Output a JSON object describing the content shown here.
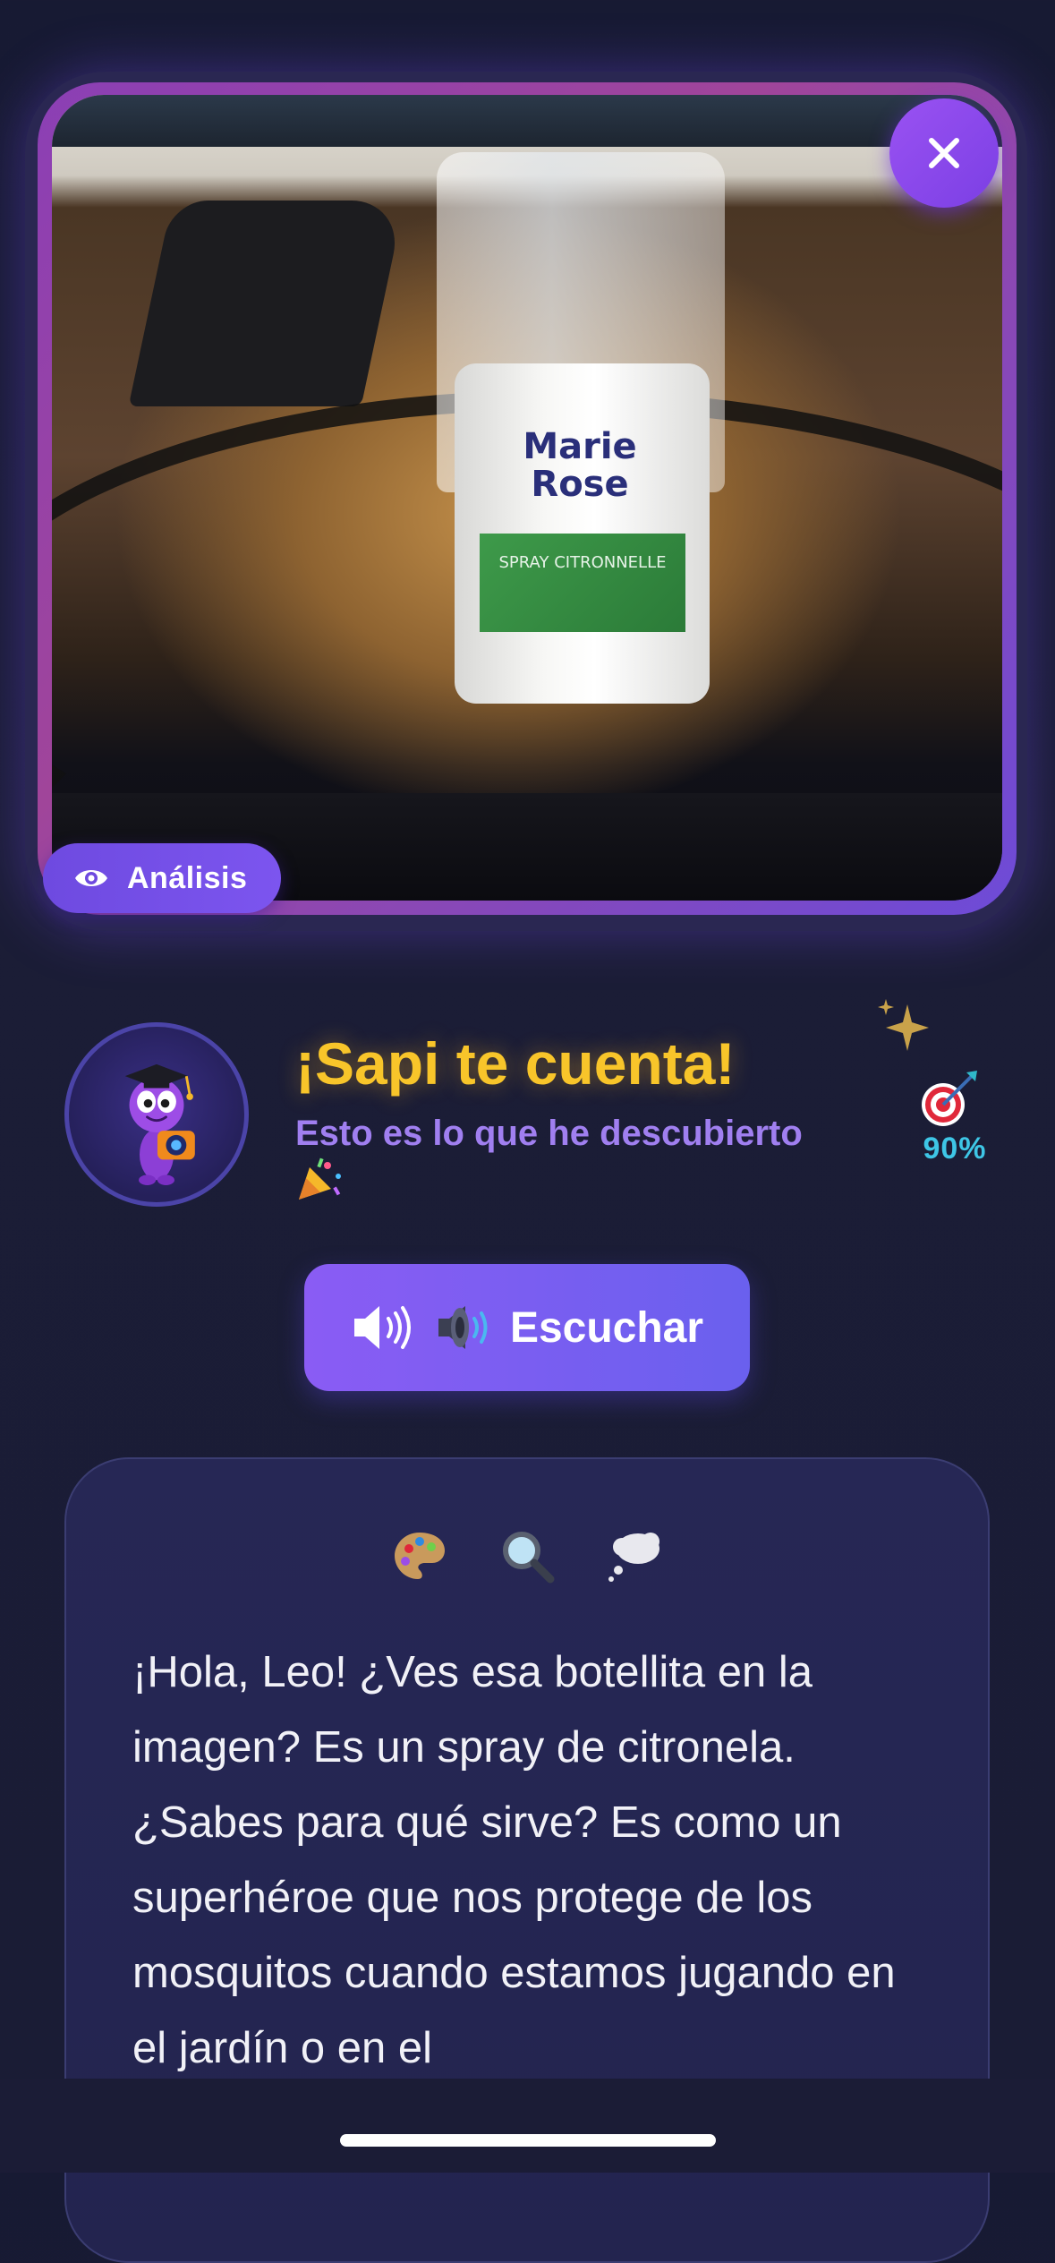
{
  "photo": {
    "product_brand": "Marie Rose",
    "product_label": "SPRAY CITRONNELLE"
  },
  "badge": {
    "label": "Análisis",
    "icon": "eye-icon"
  },
  "close_button": {
    "icon": "close-icon"
  },
  "header": {
    "title": "¡Sapi te cuenta!",
    "subtitle": "Esto es lo que he descubierto",
    "avatar_icon": "sapi-mascot-icon",
    "confidence": "90%",
    "confidence_icon": "target-icon",
    "sparkles_icon": "sparkles-icon",
    "party_icon": "party-popper-icon"
  },
  "listen_button": {
    "label": "Escuchar",
    "icons": [
      "speaker-icon",
      "speaker-emoji-icon"
    ]
  },
  "story": {
    "icons": [
      "palette-icon",
      "magnifier-icon",
      "thought-bubble-icon"
    ],
    "text": "¡Hola, Leo! ¿Ves esa botellita en la imagen? Es un spray de citronela. ¿Sabes para qué sirve? Es como un superhéroe que nos protege de los mosquitos cuando estamos jugando en el jardín o en el"
  },
  "colors": {
    "background": "#1a1c35",
    "accent_purple": "#7c55ef",
    "title_yellow": "#f8c52a",
    "subtitle_purple": "#a07ff0",
    "confidence_cyan": "#3ec6e6",
    "card": "#262755"
  }
}
